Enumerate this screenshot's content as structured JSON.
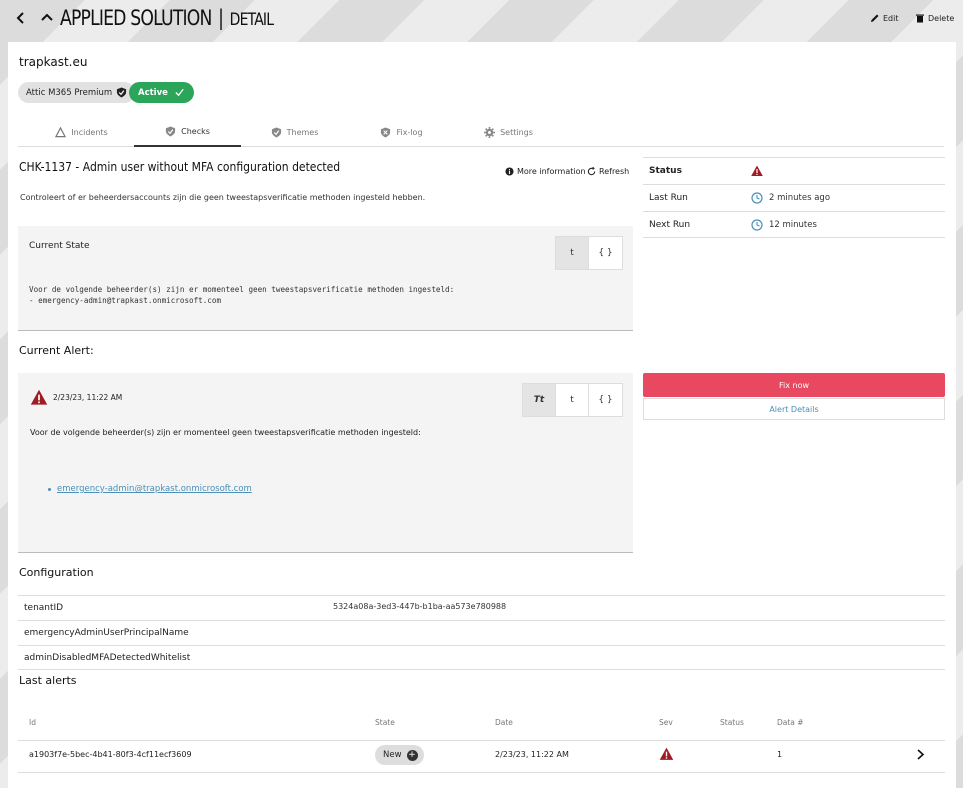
{
  "header": {
    "title": "APPLIED SOLUTION",
    "separator": "|",
    "subtitle": "DETAIL",
    "edit_label": "Edit",
    "delete_label": "Delete"
  },
  "tenant": "trapkast.eu",
  "badges": {
    "product": "Attic M365 Premium",
    "status": "Active"
  },
  "tabs": [
    {
      "label": "Incidents",
      "icon": "triangle-icon"
    },
    {
      "label": "Checks",
      "icon": "shield-check-icon",
      "active": true
    },
    {
      "label": "Themes",
      "icon": "shield-check-icon"
    },
    {
      "label": "Fix-log",
      "icon": "shield-x-icon"
    },
    {
      "label": "Settings",
      "icon": "gear-icon"
    }
  ],
  "check": {
    "title": "CHK-1137 - Admin user without MFA configuration detected",
    "more_info": "More information",
    "refresh": "Refresh",
    "description": "Controleert of er beheerdersaccounts zijn die geen tweestapsverificatie methoden ingesteld hebben."
  },
  "current_state": {
    "label": "Current State",
    "line1": "Voor de volgende beheerder(s) zijn er momenteel geen tweestapsverificatie methoden ingesteld:",
    "line2": "- emergency-admin@trapkast.onmicrosoft.com",
    "toggle": [
      "t",
      "{ }"
    ]
  },
  "status_panel": {
    "status_label": "Status",
    "last_run_label": "Last Run",
    "last_run_value": "2 minutes ago",
    "next_run_label": "Next Run",
    "next_run_value": "12 minutes"
  },
  "current_alert": {
    "section_title": "Current Alert:",
    "timestamp": "2/23/23, 11:22 AM",
    "text": "Voor de volgende beheerder(s) zijn er momenteel geen tweestapsverificatie methoden ingesteld:",
    "item": "emergency-admin@trapkast.onmicrosoft.com",
    "toggle": [
      "Tt",
      "t",
      "{ }"
    ]
  },
  "actions": {
    "fix_now": "Fix now",
    "alert_details": "Alert Details"
  },
  "configuration": {
    "title": "Configuration",
    "rows": [
      {
        "key": "tenantID",
        "value": "5324a08a-3ed3-447b-b1ba-aa573e780988"
      },
      {
        "key": "emergencyAdminUserPrincipalName",
        "value": ""
      },
      {
        "key": "adminDisabledMFADetectedWhitelist",
        "value": ""
      }
    ]
  },
  "last_alerts": {
    "title": "Last alerts",
    "columns": [
      "Id",
      "State",
      "Date",
      "Sev",
      "Status",
      "Data #"
    ],
    "rows": [
      {
        "id": "a1903f7e-5bec-4b41-80f3-4cf11ecf3609",
        "state": "New",
        "date": "2/23/23, 11:22 AM",
        "status": "",
        "data_count": "1"
      }
    ]
  },
  "colors": {
    "accent_red": "#e84860",
    "active_green": "#2aa55a",
    "severity_red": "#a01c24",
    "link_blue": "#4a90b8"
  }
}
